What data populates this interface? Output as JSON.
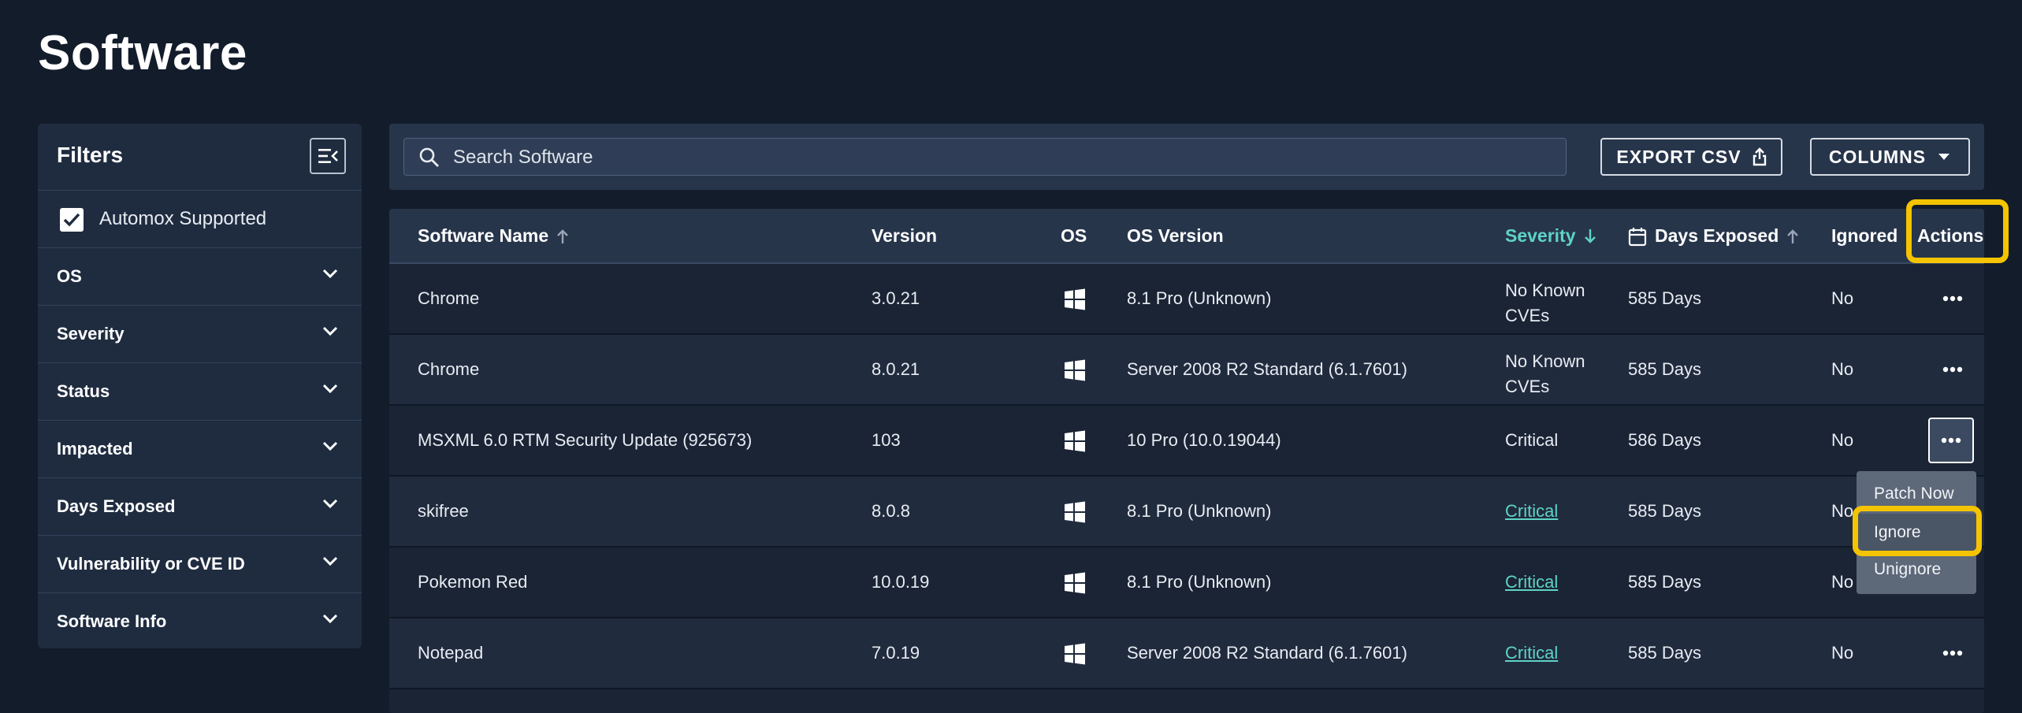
{
  "page": {
    "title": "Software"
  },
  "filters": {
    "title": "Filters",
    "checkbox": {
      "label": "Automox Supported",
      "checked": true
    },
    "items": [
      {
        "label": "OS"
      },
      {
        "label": "Severity"
      },
      {
        "label": "Status"
      },
      {
        "label": "Impacted"
      },
      {
        "label": "Days Exposed"
      },
      {
        "label": "Vulnerability or CVE ID"
      },
      {
        "label": "Software Info"
      }
    ]
  },
  "toolbar": {
    "search_placeholder": "Search Software",
    "export_label": "EXPORT CSV",
    "columns_label": "COLUMNS"
  },
  "table": {
    "headers": {
      "name": "Software Name",
      "version": "Version",
      "os": "OS",
      "os_version": "OS Version",
      "severity": "Severity",
      "days": "Days Exposed",
      "ignored": "Ignored",
      "actions": "Actions"
    },
    "rows": [
      {
        "name": "Chrome",
        "version": "3.0.21",
        "os_icon": "windows-icon",
        "os_version": "8.1 Pro (Unknown)",
        "severity": "No Known CVEs",
        "days": "585 Days",
        "ignored": "No"
      },
      {
        "name": "Chrome",
        "version": "8.0.21",
        "os_icon": "windows-icon",
        "os_version": "Server 2008 R2 Standard (6.1.7601)",
        "severity": "No Known CVEs",
        "days": "585 Days",
        "ignored": "No"
      },
      {
        "name": "MSXML 6.0 RTM Security Update (925673)",
        "version": "103",
        "os_icon": "windows-icon",
        "os_version": "10 Pro (10.0.19044)",
        "severity": "Critical",
        "days": "586 Days",
        "ignored": "No"
      },
      {
        "name": "skifree",
        "version": "8.0.8",
        "os_icon": "windows-icon",
        "os_version": "8.1 Pro (Unknown)",
        "severity": "Critical",
        "days": "585 Days",
        "ignored": "No"
      },
      {
        "name": "Pokemon Red",
        "version": "10.0.19",
        "os_icon": "windows-icon",
        "os_version": "8.1 Pro (Unknown)",
        "severity": "Critical",
        "days": "585 Days",
        "ignored": "No"
      },
      {
        "name": "Notepad",
        "version": "7.0.19",
        "os_icon": "windows-icon",
        "os_version": "Server 2008 R2 Standard (6.1.7601)",
        "severity": "Critical",
        "days": "585 Days",
        "ignored": "No"
      }
    ]
  },
  "actions_menu": {
    "items": [
      "Patch Now",
      "Ignore",
      "Unignore"
    ],
    "selected": "Ignore"
  },
  "colors": {
    "accent": "#5fd3c7",
    "highlight": "#f5c400",
    "background": "#131c2b"
  }
}
